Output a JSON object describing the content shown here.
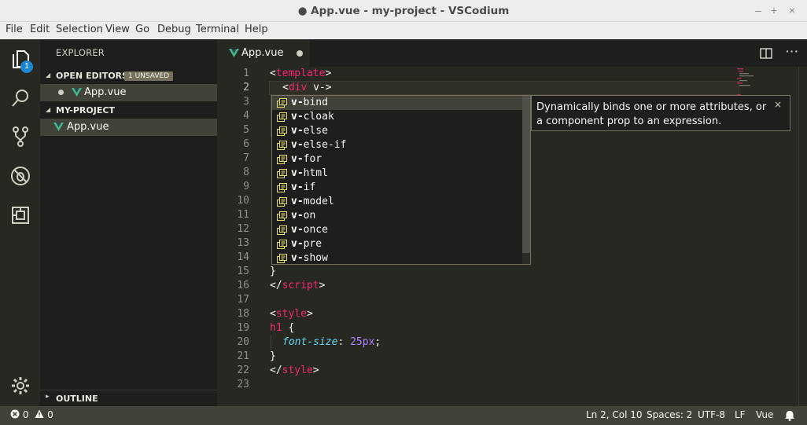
{
  "window": {
    "title": "● App.vue - my-project - VSCodium"
  },
  "menu": [
    "File",
    "Edit",
    "Selection",
    "View",
    "Go",
    "Debug",
    "Terminal",
    "Help"
  ],
  "activity": {
    "explorer_badge": "1",
    "items": [
      "explorer-icon",
      "search-icon",
      "source-control-icon",
      "debug-icon",
      "extensions-icon",
      "gear-icon"
    ]
  },
  "sidebar": {
    "title": "EXPLORER",
    "open_editors": {
      "label": "OPEN EDITORS",
      "badge": "1 UNSAVED",
      "files": [
        "App.vue"
      ]
    },
    "project": {
      "label": "MY-PROJECT",
      "files": [
        "App.vue"
      ]
    },
    "outline": {
      "label": "OUTLINE"
    }
  },
  "tab": {
    "label": "App.vue"
  },
  "editor": {
    "line_numbers": [
      "1",
      "2",
      "3",
      "4",
      "5",
      "6",
      "7",
      "8",
      "9",
      "10",
      "11",
      "12",
      "13",
      "14",
      "15",
      "16",
      "17",
      "18",
      "19",
      "20",
      "21",
      "22",
      "23"
    ],
    "code_tokens": {
      "l1": [
        "<",
        "template",
        ">"
      ],
      "l2": [
        "<",
        "div",
        " v-",
        ">"
      ],
      "l15": [
        "}"
      ],
      "l16": [
        "</",
        "script",
        ">"
      ],
      "l18": [
        "<",
        "style",
        ">"
      ],
      "l19": [
        "h1",
        " {"
      ],
      "l20": [
        "font-size",
        ": ",
        "25px",
        ";"
      ],
      "l21": [
        "}"
      ],
      "l22": [
        "</",
        "style",
        ">"
      ]
    }
  },
  "suggest": {
    "typed": "v-",
    "items": [
      "bind",
      "cloak",
      "else",
      "else-if",
      "for",
      "html",
      "if",
      "model",
      "on",
      "once",
      "pre",
      "show"
    ],
    "details": "Dynamically binds one or more attributes, or a component prop to an expression.",
    "close": "×"
  },
  "status": {
    "errors": "0",
    "warnings": "0",
    "position": "Ln 2, Col 10",
    "spaces": "Spaces: 2",
    "encoding": "UTF-8",
    "eol": "LF",
    "language": "Vue"
  },
  "colors": {
    "accent": "#1e86d0",
    "tag": "#f92672",
    "number": "#ae81ff",
    "property": "#66d9ef",
    "vue_green": "#41b883"
  }
}
